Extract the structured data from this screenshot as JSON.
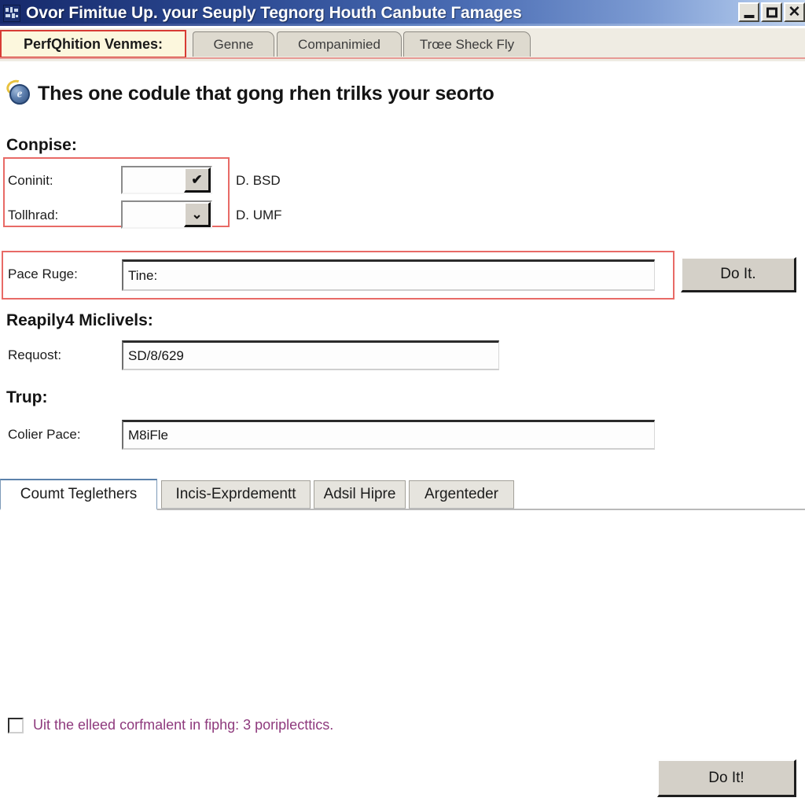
{
  "window": {
    "title": "Ovor Fimitue Up. your Seuply Tegnorg Houth Canbute Γamages",
    "app_icon": "app-window-icon",
    "controls": {
      "minimize": "–",
      "maximize": "□",
      "close": "✕"
    },
    "titlebar_color_left": "#16296b",
    "titlebar_color_right": "#c6d9f2"
  },
  "top_tabs": [
    {
      "label": "PerfQhition Venmes:",
      "selected": true
    },
    {
      "label": "Genne",
      "selected": false
    },
    {
      "label": "Companimied",
      "selected": false
    },
    {
      "label": "Trœe Sheck Fly",
      "selected": false
    }
  ],
  "heading": {
    "icon": "globe-browser-icon",
    "text": "Thes one codule that gong rhen trilks your seorto"
  },
  "conpise": {
    "title": "Conpise:",
    "rows": [
      {
        "label": "Coninit:",
        "dropdown_value": "",
        "dropdown_glyph": "✔",
        "note": "D. BSD"
      },
      {
        "label": "Tollhrad:",
        "dropdown_value": "",
        "dropdown_glyph": "⌄",
        "note": "D. UMF"
      }
    ],
    "highlight_color": "#e86a66"
  },
  "pace_ruge": {
    "label": "Pace Ruge:",
    "value": "Tine:",
    "button_label": "Do It.",
    "highlight_color": "#e86a66"
  },
  "reapily": {
    "title": "Reapily4 Miclivels:",
    "label": "Requost:",
    "value": "SD/8/629"
  },
  "trup": {
    "title": "Trup:",
    "label": "Colier Pace:",
    "value": "M8iFle"
  },
  "lower_tabs": [
    {
      "label": "Coumt Teglethers",
      "selected": true
    },
    {
      "label": "Incis-Exprdementt",
      "selected": false
    },
    {
      "label": "Adsil Hipre",
      "selected": false
    },
    {
      "label": "Argenteder",
      "selected": false
    }
  ],
  "bottom": {
    "checkbox_checked": false,
    "checkbox_label": "Uit the elleed corfmalent in fiphg: 3 poriplecttics.",
    "checkbox_label_color": "#8e3a7d",
    "action_button": "Do It!"
  }
}
